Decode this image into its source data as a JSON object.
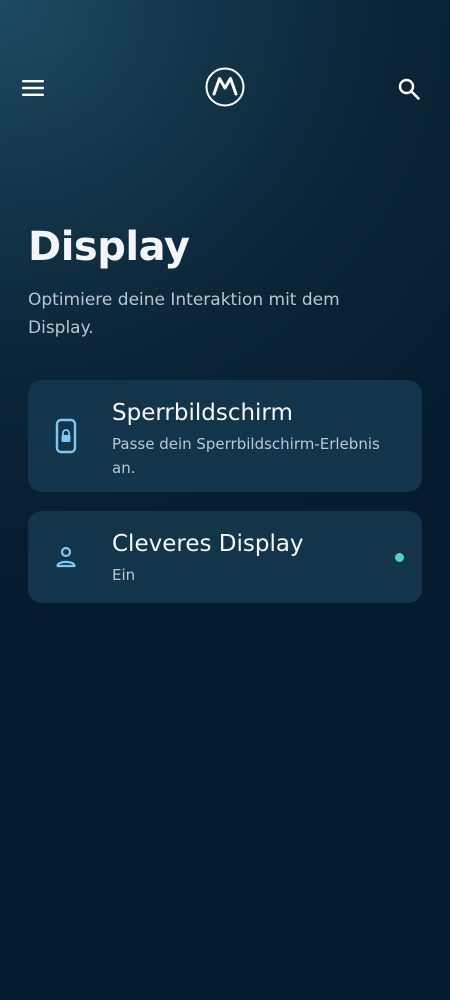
{
  "header": {
    "menu_icon": "hamburger-menu-icon",
    "logo_icon": "motorola-logo-icon",
    "search_icon": "search-icon"
  },
  "page": {
    "title": "Display",
    "subtitle": "Optimiere deine Interaktion mit dem Display."
  },
  "cards": [
    {
      "icon": "lock-screen-phone-icon",
      "title": "Sperrbildschirm",
      "description": "Passe dein Sperrbildschirm-Erlebnis an."
    },
    {
      "icon": "person-icon",
      "title": "Cleveres Display",
      "description": "Ein",
      "status": "on"
    }
  ],
  "colors": {
    "accent_icon": "#7fc7f2",
    "status_on": "#49d7c0",
    "card_background": "#13354b"
  }
}
